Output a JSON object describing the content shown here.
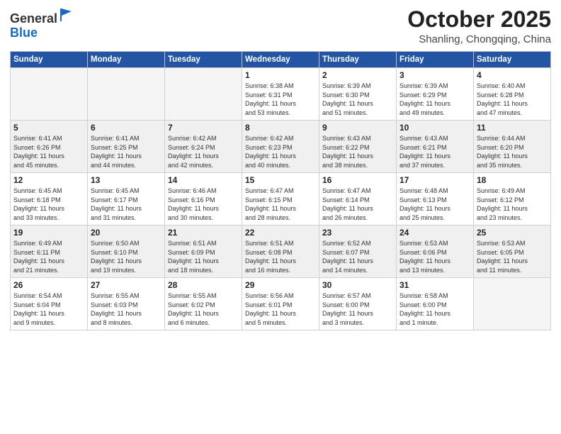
{
  "header": {
    "logo_general": "General",
    "logo_blue": "Blue",
    "month": "October 2025",
    "location": "Shanling, Chongqing, China"
  },
  "weekdays": [
    "Sunday",
    "Monday",
    "Tuesday",
    "Wednesday",
    "Thursday",
    "Friday",
    "Saturday"
  ],
  "weeks": [
    [
      {
        "day": "",
        "info": ""
      },
      {
        "day": "",
        "info": ""
      },
      {
        "day": "",
        "info": ""
      },
      {
        "day": "1",
        "info": "Sunrise: 6:38 AM\nSunset: 6:31 PM\nDaylight: 11 hours\nand 53 minutes."
      },
      {
        "day": "2",
        "info": "Sunrise: 6:39 AM\nSunset: 6:30 PM\nDaylight: 11 hours\nand 51 minutes."
      },
      {
        "day": "3",
        "info": "Sunrise: 6:39 AM\nSunset: 6:29 PM\nDaylight: 11 hours\nand 49 minutes."
      },
      {
        "day": "4",
        "info": "Sunrise: 6:40 AM\nSunset: 6:28 PM\nDaylight: 11 hours\nand 47 minutes."
      }
    ],
    [
      {
        "day": "5",
        "info": "Sunrise: 6:41 AM\nSunset: 6:26 PM\nDaylight: 11 hours\nand 45 minutes."
      },
      {
        "day": "6",
        "info": "Sunrise: 6:41 AM\nSunset: 6:25 PM\nDaylight: 11 hours\nand 44 minutes."
      },
      {
        "day": "7",
        "info": "Sunrise: 6:42 AM\nSunset: 6:24 PM\nDaylight: 11 hours\nand 42 minutes."
      },
      {
        "day": "8",
        "info": "Sunrise: 6:42 AM\nSunset: 6:23 PM\nDaylight: 11 hours\nand 40 minutes."
      },
      {
        "day": "9",
        "info": "Sunrise: 6:43 AM\nSunset: 6:22 PM\nDaylight: 11 hours\nand 38 minutes."
      },
      {
        "day": "10",
        "info": "Sunrise: 6:43 AM\nSunset: 6:21 PM\nDaylight: 11 hours\nand 37 minutes."
      },
      {
        "day": "11",
        "info": "Sunrise: 6:44 AM\nSunset: 6:20 PM\nDaylight: 11 hours\nand 35 minutes."
      }
    ],
    [
      {
        "day": "12",
        "info": "Sunrise: 6:45 AM\nSunset: 6:18 PM\nDaylight: 11 hours\nand 33 minutes."
      },
      {
        "day": "13",
        "info": "Sunrise: 6:45 AM\nSunset: 6:17 PM\nDaylight: 11 hours\nand 31 minutes."
      },
      {
        "day": "14",
        "info": "Sunrise: 6:46 AM\nSunset: 6:16 PM\nDaylight: 11 hours\nand 30 minutes."
      },
      {
        "day": "15",
        "info": "Sunrise: 6:47 AM\nSunset: 6:15 PM\nDaylight: 11 hours\nand 28 minutes."
      },
      {
        "day": "16",
        "info": "Sunrise: 6:47 AM\nSunset: 6:14 PM\nDaylight: 11 hours\nand 26 minutes."
      },
      {
        "day": "17",
        "info": "Sunrise: 6:48 AM\nSunset: 6:13 PM\nDaylight: 11 hours\nand 25 minutes."
      },
      {
        "day": "18",
        "info": "Sunrise: 6:49 AM\nSunset: 6:12 PM\nDaylight: 11 hours\nand 23 minutes."
      }
    ],
    [
      {
        "day": "19",
        "info": "Sunrise: 6:49 AM\nSunset: 6:11 PM\nDaylight: 11 hours\nand 21 minutes."
      },
      {
        "day": "20",
        "info": "Sunrise: 6:50 AM\nSunset: 6:10 PM\nDaylight: 11 hours\nand 19 minutes."
      },
      {
        "day": "21",
        "info": "Sunrise: 6:51 AM\nSunset: 6:09 PM\nDaylight: 11 hours\nand 18 minutes."
      },
      {
        "day": "22",
        "info": "Sunrise: 6:51 AM\nSunset: 6:08 PM\nDaylight: 11 hours\nand 16 minutes."
      },
      {
        "day": "23",
        "info": "Sunrise: 6:52 AM\nSunset: 6:07 PM\nDaylight: 11 hours\nand 14 minutes."
      },
      {
        "day": "24",
        "info": "Sunrise: 6:53 AM\nSunset: 6:06 PM\nDaylight: 11 hours\nand 13 minutes."
      },
      {
        "day": "25",
        "info": "Sunrise: 6:53 AM\nSunset: 6:05 PM\nDaylight: 11 hours\nand 11 minutes."
      }
    ],
    [
      {
        "day": "26",
        "info": "Sunrise: 6:54 AM\nSunset: 6:04 PM\nDaylight: 11 hours\nand 9 minutes."
      },
      {
        "day": "27",
        "info": "Sunrise: 6:55 AM\nSunset: 6:03 PM\nDaylight: 11 hours\nand 8 minutes."
      },
      {
        "day": "28",
        "info": "Sunrise: 6:55 AM\nSunset: 6:02 PM\nDaylight: 11 hours\nand 6 minutes."
      },
      {
        "day": "29",
        "info": "Sunrise: 6:56 AM\nSunset: 6:01 PM\nDaylight: 11 hours\nand 5 minutes."
      },
      {
        "day": "30",
        "info": "Sunrise: 6:57 AM\nSunset: 6:00 PM\nDaylight: 11 hours\nand 3 minutes."
      },
      {
        "day": "31",
        "info": "Sunrise: 6:58 AM\nSunset: 6:00 PM\nDaylight: 11 hours\nand 1 minute."
      },
      {
        "day": "",
        "info": ""
      }
    ]
  ]
}
